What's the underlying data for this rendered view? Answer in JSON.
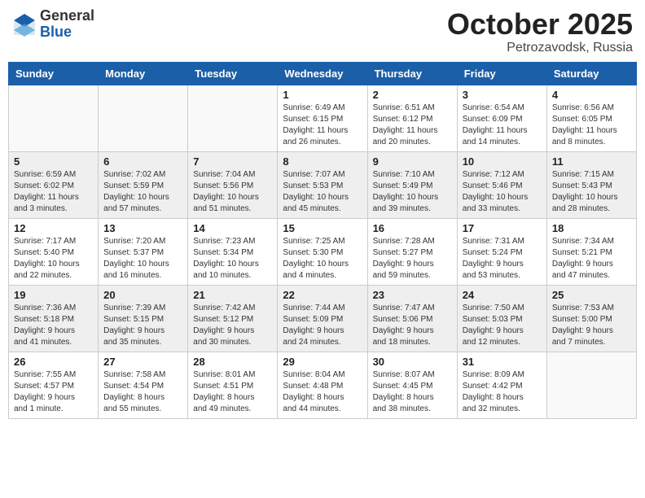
{
  "header": {
    "logo_general": "General",
    "logo_blue": "Blue",
    "month": "October 2025",
    "location": "Petrozavodsk, Russia"
  },
  "weekdays": [
    "Sunday",
    "Monday",
    "Tuesday",
    "Wednesday",
    "Thursday",
    "Friday",
    "Saturday"
  ],
  "weeks": [
    [
      {
        "day": "",
        "info": ""
      },
      {
        "day": "",
        "info": ""
      },
      {
        "day": "",
        "info": ""
      },
      {
        "day": "1",
        "info": "Sunrise: 6:49 AM\nSunset: 6:15 PM\nDaylight: 11 hours\nand 26 minutes."
      },
      {
        "day": "2",
        "info": "Sunrise: 6:51 AM\nSunset: 6:12 PM\nDaylight: 11 hours\nand 20 minutes."
      },
      {
        "day": "3",
        "info": "Sunrise: 6:54 AM\nSunset: 6:09 PM\nDaylight: 11 hours\nand 14 minutes."
      },
      {
        "day": "4",
        "info": "Sunrise: 6:56 AM\nSunset: 6:05 PM\nDaylight: 11 hours\nand 8 minutes."
      }
    ],
    [
      {
        "day": "5",
        "info": "Sunrise: 6:59 AM\nSunset: 6:02 PM\nDaylight: 11 hours\nand 3 minutes."
      },
      {
        "day": "6",
        "info": "Sunrise: 7:02 AM\nSunset: 5:59 PM\nDaylight: 10 hours\nand 57 minutes."
      },
      {
        "day": "7",
        "info": "Sunrise: 7:04 AM\nSunset: 5:56 PM\nDaylight: 10 hours\nand 51 minutes."
      },
      {
        "day": "8",
        "info": "Sunrise: 7:07 AM\nSunset: 5:53 PM\nDaylight: 10 hours\nand 45 minutes."
      },
      {
        "day": "9",
        "info": "Sunrise: 7:10 AM\nSunset: 5:49 PM\nDaylight: 10 hours\nand 39 minutes."
      },
      {
        "day": "10",
        "info": "Sunrise: 7:12 AM\nSunset: 5:46 PM\nDaylight: 10 hours\nand 33 minutes."
      },
      {
        "day": "11",
        "info": "Sunrise: 7:15 AM\nSunset: 5:43 PM\nDaylight: 10 hours\nand 28 minutes."
      }
    ],
    [
      {
        "day": "12",
        "info": "Sunrise: 7:17 AM\nSunset: 5:40 PM\nDaylight: 10 hours\nand 22 minutes."
      },
      {
        "day": "13",
        "info": "Sunrise: 7:20 AM\nSunset: 5:37 PM\nDaylight: 10 hours\nand 16 minutes."
      },
      {
        "day": "14",
        "info": "Sunrise: 7:23 AM\nSunset: 5:34 PM\nDaylight: 10 hours\nand 10 minutes."
      },
      {
        "day": "15",
        "info": "Sunrise: 7:25 AM\nSunset: 5:30 PM\nDaylight: 10 hours\nand 4 minutes."
      },
      {
        "day": "16",
        "info": "Sunrise: 7:28 AM\nSunset: 5:27 PM\nDaylight: 9 hours\nand 59 minutes."
      },
      {
        "day": "17",
        "info": "Sunrise: 7:31 AM\nSunset: 5:24 PM\nDaylight: 9 hours\nand 53 minutes."
      },
      {
        "day": "18",
        "info": "Sunrise: 7:34 AM\nSunset: 5:21 PM\nDaylight: 9 hours\nand 47 minutes."
      }
    ],
    [
      {
        "day": "19",
        "info": "Sunrise: 7:36 AM\nSunset: 5:18 PM\nDaylight: 9 hours\nand 41 minutes."
      },
      {
        "day": "20",
        "info": "Sunrise: 7:39 AM\nSunset: 5:15 PM\nDaylight: 9 hours\nand 35 minutes."
      },
      {
        "day": "21",
        "info": "Sunrise: 7:42 AM\nSunset: 5:12 PM\nDaylight: 9 hours\nand 30 minutes."
      },
      {
        "day": "22",
        "info": "Sunrise: 7:44 AM\nSunset: 5:09 PM\nDaylight: 9 hours\nand 24 minutes."
      },
      {
        "day": "23",
        "info": "Sunrise: 7:47 AM\nSunset: 5:06 PM\nDaylight: 9 hours\nand 18 minutes."
      },
      {
        "day": "24",
        "info": "Sunrise: 7:50 AM\nSunset: 5:03 PM\nDaylight: 9 hours\nand 12 minutes."
      },
      {
        "day": "25",
        "info": "Sunrise: 7:53 AM\nSunset: 5:00 PM\nDaylight: 9 hours\nand 7 minutes."
      }
    ],
    [
      {
        "day": "26",
        "info": "Sunrise: 7:55 AM\nSunset: 4:57 PM\nDaylight: 9 hours\nand 1 minute."
      },
      {
        "day": "27",
        "info": "Sunrise: 7:58 AM\nSunset: 4:54 PM\nDaylight: 8 hours\nand 55 minutes."
      },
      {
        "day": "28",
        "info": "Sunrise: 8:01 AM\nSunset: 4:51 PM\nDaylight: 8 hours\nand 49 minutes."
      },
      {
        "day": "29",
        "info": "Sunrise: 8:04 AM\nSunset: 4:48 PM\nDaylight: 8 hours\nand 44 minutes."
      },
      {
        "day": "30",
        "info": "Sunrise: 8:07 AM\nSunset: 4:45 PM\nDaylight: 8 hours\nand 38 minutes."
      },
      {
        "day": "31",
        "info": "Sunrise: 8:09 AM\nSunset: 4:42 PM\nDaylight: 8 hours\nand 32 minutes."
      },
      {
        "day": "",
        "info": ""
      }
    ]
  ]
}
